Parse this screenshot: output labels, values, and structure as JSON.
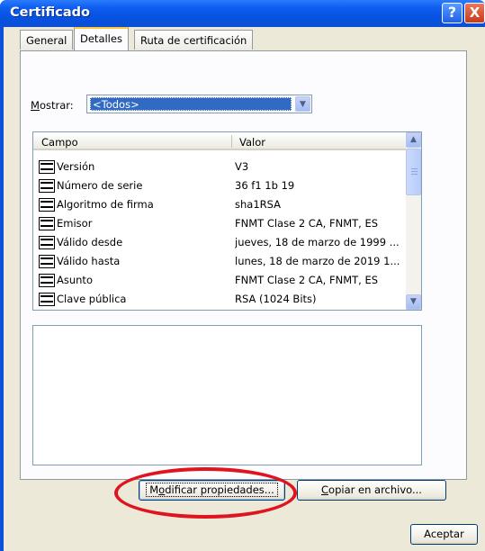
{
  "window": {
    "title": "Certificado",
    "help_glyph": "?",
    "close_glyph": "X"
  },
  "tabs": [
    {
      "label": "General",
      "active": false
    },
    {
      "label": "Detalles",
      "active": true
    },
    {
      "label": "Ruta de certificación",
      "active": false
    }
  ],
  "show_filter": {
    "label_mnemonic": "M",
    "label_rest": "ostrar:",
    "selected": "<Todos>"
  },
  "fields_list": {
    "columns": [
      "Campo",
      "Valor"
    ],
    "rows": [
      {
        "campo": "Versión",
        "valor": "V3"
      },
      {
        "campo": "Número de serie",
        "valor": "36 f1 1b 19"
      },
      {
        "campo": "Algoritmo de firma",
        "valor": "sha1RSA"
      },
      {
        "campo": "Emisor",
        "valor": "FNMT Clase 2 CA, FNMT, ES"
      },
      {
        "campo": "Válido desde",
        "valor": "jueves, 18 de marzo de 1999 ..."
      },
      {
        "campo": "Válido hasta",
        "valor": "lunes, 18 de marzo de 2019 1..."
      },
      {
        "campo": "Asunto",
        "valor": "FNMT Clase 2 CA, FNMT, ES"
      },
      {
        "campo": "Clave pública",
        "valor": "RSA (1024 Bits)"
      }
    ]
  },
  "buttons": {
    "edit_properties_mnemonic": "o",
    "edit_properties_pre": "M",
    "edit_properties_post": "dificar propiedades...",
    "copy_to_file_mnemonic": "C",
    "copy_to_file_rest": "opiar en archivo...",
    "ok": "Aceptar"
  },
  "annotation": {
    "color": "#e0141e"
  },
  "colors": {
    "titlebar": "#0a52d8",
    "selection": "#316ac5",
    "dialog_bg": "#ece9d8"
  }
}
